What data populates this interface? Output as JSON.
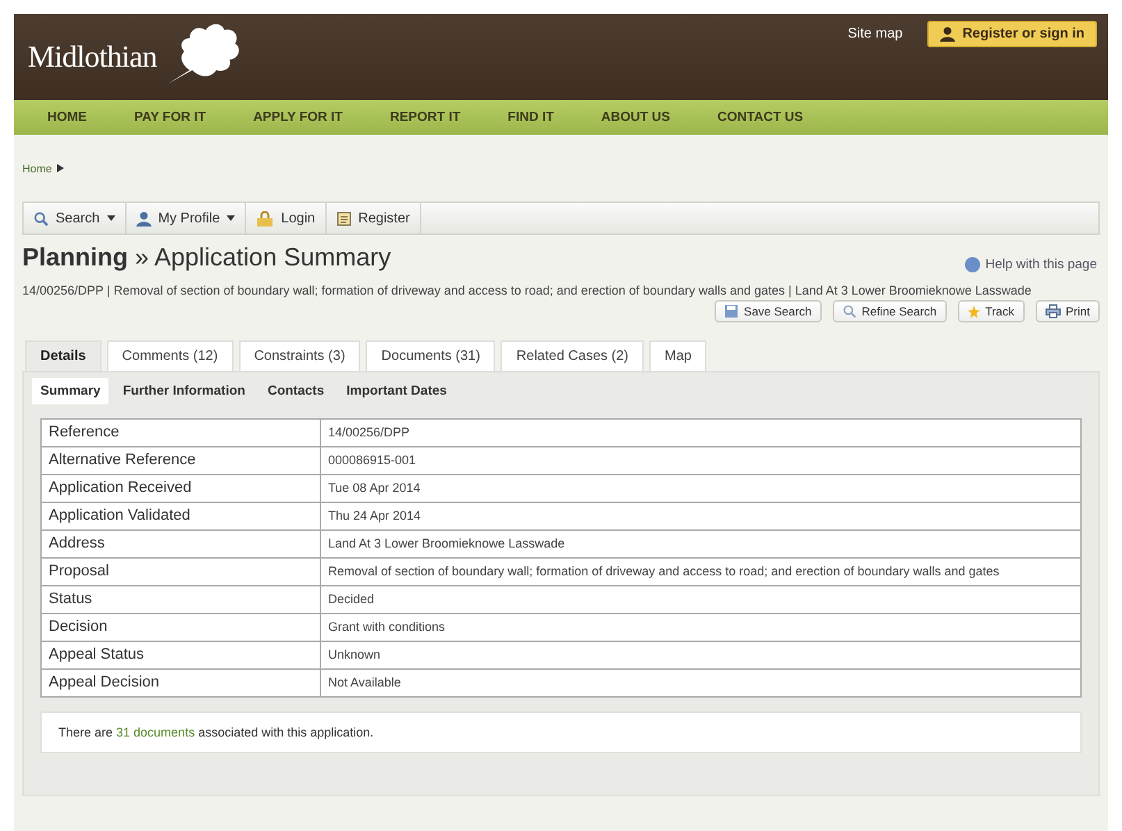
{
  "header": {
    "logo": "Midlothian",
    "site_map": "Site map",
    "register_button": "Register or sign in"
  },
  "nav": [
    "HOME",
    "PAY FOR IT",
    "APPLY FOR IT",
    "REPORT IT",
    "FIND IT",
    "ABOUT US",
    "CONTACT US"
  ],
  "breadcrumb": [
    "Home"
  ],
  "toolbar": [
    {
      "label": "Search",
      "kind": "search",
      "dropdown": true
    },
    {
      "label": "My Profile",
      "kind": "profile",
      "dropdown": true
    },
    {
      "label": "Login",
      "kind": "login",
      "dropdown": false
    },
    {
      "label": "Register",
      "kind": "register",
      "dropdown": false
    }
  ],
  "heading": {
    "section": "Planning",
    "separator": "»",
    "title": "Application Summary"
  },
  "help_link": "Help with this page",
  "description": "14/00256/DPP | Removal of section of boundary wall; formation of driveway and access to road; and erection of boundary walls and gates | Land At 3 Lower Broomieknowe Lasswade",
  "actions": [
    {
      "label": "Save Search",
      "kind": "save"
    },
    {
      "label": "Refine Search",
      "kind": "refine"
    },
    {
      "label": "Track",
      "kind": "track"
    },
    {
      "label": "Print",
      "kind": "print"
    }
  ],
  "tabs": [
    {
      "label": "Details",
      "selected": true
    },
    {
      "label": "Comments (12)",
      "selected": false
    },
    {
      "label": "Constraints (3)",
      "selected": false
    },
    {
      "label": "Documents (31)",
      "selected": false
    },
    {
      "label": "Related Cases (2)",
      "selected": false
    },
    {
      "label": "Map",
      "selected": false
    }
  ],
  "subtabs": [
    {
      "label": "Summary",
      "selected": true
    },
    {
      "label": "Further Information",
      "selected": false
    },
    {
      "label": "Contacts",
      "selected": false
    },
    {
      "label": "Important Dates",
      "selected": false
    }
  ],
  "table": {
    "rows": [
      {
        "label": "Reference",
        "value": "14/00256/DPP"
      },
      {
        "label": "Alternative Reference",
        "value": "000086915-001"
      },
      {
        "label": "Application Received",
        "value": "Tue 08 Apr 2014"
      },
      {
        "label": "Application Validated",
        "value": "Thu 24 Apr 2014"
      },
      {
        "label": "Address",
        "value": "Land At 3 Lower Broomieknowe Lasswade"
      },
      {
        "label": "Proposal",
        "value": "Removal of section of boundary wall; formation of driveway and access to road; and erection of boundary walls and gates"
      },
      {
        "label": "Status",
        "value": "Decided"
      },
      {
        "label": "Decision",
        "value": "Grant with conditions"
      },
      {
        "label": "Appeal Status",
        "value": "Unknown"
      },
      {
        "label": "Appeal Decision",
        "value": "Not Available"
      }
    ]
  },
  "documents_note": {
    "before": "There are",
    "link": "31 documents",
    "after": "associated with this application."
  }
}
